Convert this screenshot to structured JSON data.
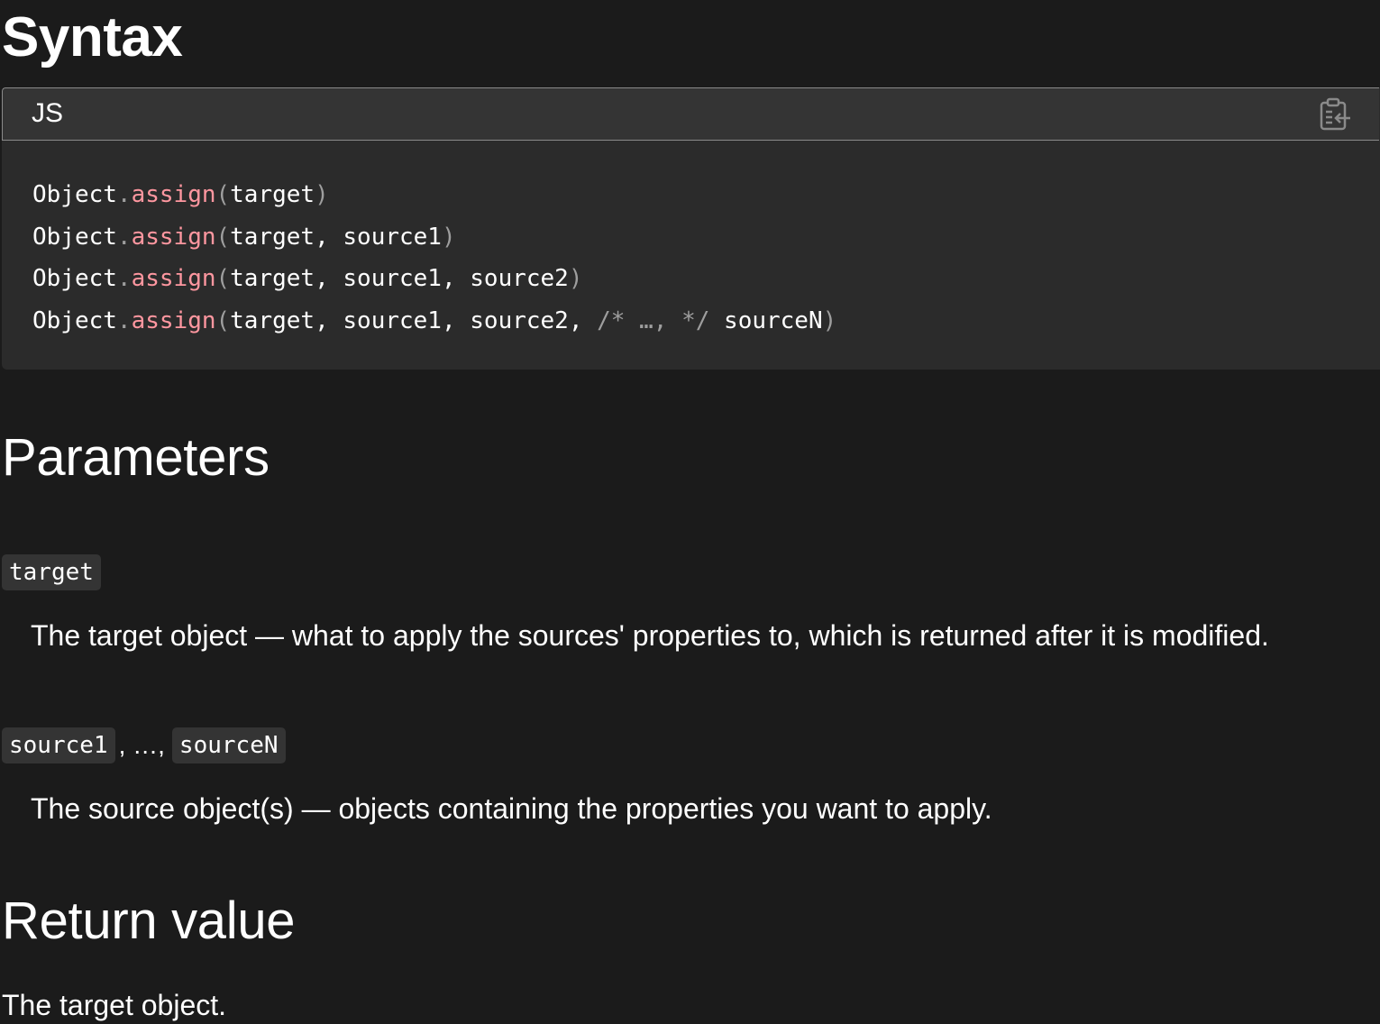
{
  "syntax": {
    "heading": "Syntax",
    "code_block": {
      "language": "JS",
      "copy_icon": "clipboard-copy-icon",
      "lines": [
        {
          "object": "Object",
          "dot": ".",
          "method": "assign",
          "open": "(",
          "args": "target",
          "close": ")"
        },
        {
          "object": "Object",
          "dot": ".",
          "method": "assign",
          "open": "(",
          "args": "target, source1",
          "close": ")"
        },
        {
          "object": "Object",
          "dot": ".",
          "method": "assign",
          "open": "(",
          "args": "target, source1, source2",
          "close": ")"
        },
        {
          "object": "Object",
          "dot": ".",
          "method": "assign",
          "open": "(",
          "args_before": "target, source1, source2, ",
          "comment": "/* …, */",
          "args_after": " sourceN",
          "close": ")"
        }
      ]
    }
  },
  "parameters": {
    "heading": "Parameters",
    "items": [
      {
        "terms": [
          "target"
        ],
        "description": "The target object — what to apply the sources' properties to, which is returned after it is modified."
      },
      {
        "terms": [
          "source1",
          "sourceN"
        ],
        "separator": ", …, ",
        "description": "The source object(s) — objects containing the properties you want to apply."
      }
    ]
  },
  "return_value": {
    "heading": "Return value",
    "text": "The target object."
  },
  "colors": {
    "background": "#1b1b1b",
    "code_background": "#2b2b2b",
    "code_header": "#343434",
    "method_token": "#ff97a0",
    "punctuation_token": "#9e9e9e"
  }
}
